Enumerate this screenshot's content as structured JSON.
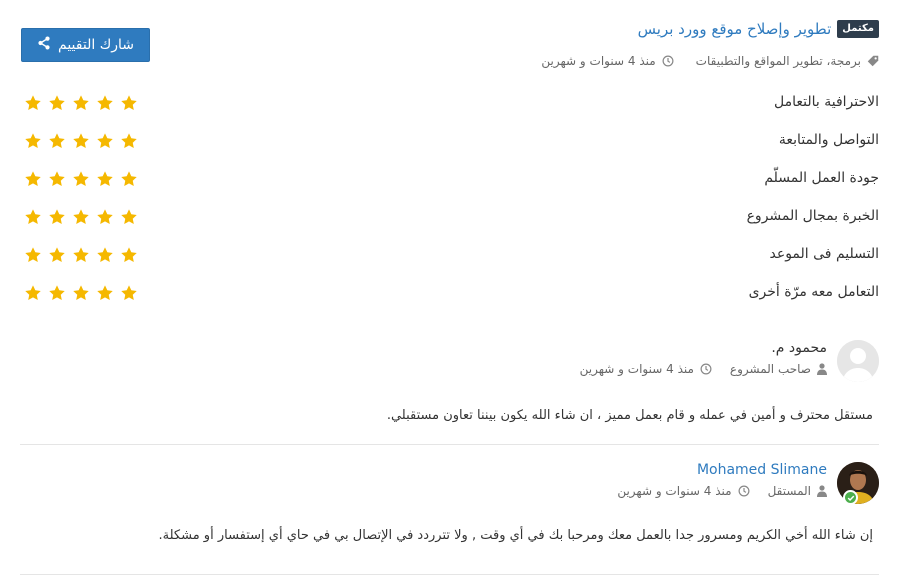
{
  "project": {
    "status_badge": "مكتمل",
    "title": "تطوير وإصلاح موقع وورد بريس",
    "categories": "برمجة، تطوير المواقع والتطبيقات",
    "time_ago": "منذ 4 سنوات و شهرين"
  },
  "share_button": {
    "label": "شارك التقييم",
    "icon": "share-icon"
  },
  "ratings": [
    {
      "label": "الاحترافية بالتعامل",
      "stars": 5
    },
    {
      "label": "التواصل والمتابعة",
      "stars": 5
    },
    {
      "label": "جودة العمل المسلّم",
      "stars": 5
    },
    {
      "label": "الخبرة بمجال المشروع",
      "stars": 5
    },
    {
      "label": "التسليم فى الموعد",
      "stars": 5
    },
    {
      "label": "التعامل معه مرّة أخرى",
      "stars": 5
    }
  ],
  "reviews": [
    {
      "name": "محمود م.",
      "role": "صاحب المشروع",
      "time_ago": "منذ 4 سنوات و شهرين",
      "text": "مستقل محترف و أمين في عمله و قام بعمل مميز ، ان شاء الله يكون بيننا تعاون مستقبلي."
    },
    {
      "name": "Mohamed Slimane",
      "role": "المستقل",
      "time_ago": "منذ 4 سنوات و شهرين",
      "text": "إن شاء الله أخي الكريم ومسرور جدا بالعمل معك ومرحبا بك في أي وقت , ولا تترردد في الإتصال بي في حاي أي إستفسار أو مشكلة."
    }
  ],
  "colors": {
    "accent": "#2f7bbf",
    "star": "#f5b800",
    "badge_bg": "#2e3d4c",
    "verified": "#4cae4c"
  }
}
